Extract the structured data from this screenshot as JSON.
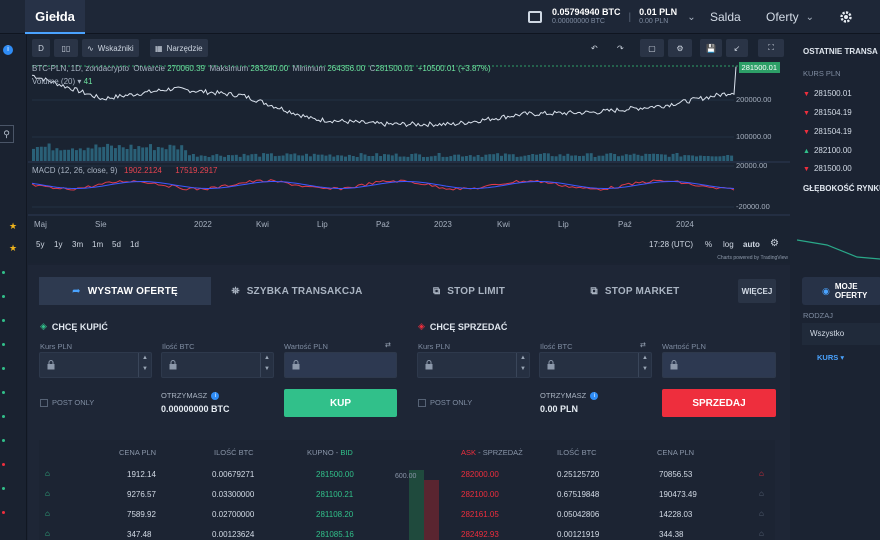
{
  "header": {
    "tab": "Giełda",
    "balance_btc": "0.05794940 BTC",
    "balance_btc_sub": "0.00000000 BTC",
    "balance_pln": "0.01 PLN",
    "balance_pln_sub": "0.00 PLN",
    "nav_salda": "Salda",
    "nav_oferty": "Oferty"
  },
  "chart_toolbar": {
    "d_label": "D",
    "indicators_label": "Wskaźniki",
    "tools_label": "Narzędzie"
  },
  "chart": {
    "symbol": "BTC-PLN, 1D, zondacrypto",
    "open_label": "Otwarcie",
    "open": "270060.39",
    "max_label": "Maksimum",
    "max": "283240.00",
    "min_label": "Minimum",
    "min": "264356.00",
    "close_label": "C",
    "close": "281500.01",
    "change": "+10500.01 (+3.87%)",
    "volume_label": "Volume (20)",
    "volume_value": "41",
    "macd_label": "MACD (12, 26, close, 9)",
    "macd_v1": "1902.2124",
    "macd_v2": "",
    "macd_v3": "17519.2917",
    "price_tag": "281500.01",
    "y_ticks": [
      "200000.00",
      "100000.00",
      "20000.00",
      "-20000.00"
    ],
    "x_ticks": [
      "Maj",
      "Sie",
      "2022",
      "Kwi",
      "Lip",
      "Paź",
      "2023",
      "Kwi",
      "Lip",
      "Paź",
      "2024"
    ],
    "timeframes": [
      "5y",
      "1y",
      "3m",
      "1m",
      "5d",
      "1d"
    ],
    "time": "17:28 (UTC)",
    "pct": "%",
    "log": "log",
    "auto": "auto",
    "powered": "Charts powered by TradingView"
  },
  "chart_data": {
    "type": "line",
    "title": "BTC-PLN, 1D, zondacrypto",
    "x": [
      "Maj",
      "Sie",
      "2022",
      "Kwi",
      "Lip",
      "Paź",
      "2023",
      "Kwi",
      "Lip",
      "Paź",
      "2024"
    ],
    "series": [
      {
        "name": "BTC-PLN",
        "values": [
          230000,
          160000,
          190000,
          170000,
          100000,
          85000,
          85000,
          115000,
          120000,
          140000,
          180000
        ]
      }
    ],
    "ylim": [
      0,
      260000
    ],
    "ylabel": "",
    "xlabel": ""
  },
  "right": {
    "title": "OSTATNIE TRANSA",
    "kurs": "KURS PLN",
    "trades": [
      {
        "dir": "down",
        "price": "281500.01"
      },
      {
        "dir": "down",
        "price": "281504.19"
      },
      {
        "dir": "down",
        "price": "281504.19"
      },
      {
        "dir": "up",
        "price": "282100.00"
      },
      {
        "dir": "down",
        "price": "281500.00"
      }
    ],
    "depth": "GŁĘBOKOŚĆ RYNKU",
    "moje": "MOJE OFERTY",
    "rodzaj": "RODZAJ",
    "wszystko": "Wszystko",
    "kurs_sort": "KURS"
  },
  "tabs": {
    "t1": "WYSTAW OFERTĘ",
    "t2": "SZYBKA TRANSAKCJA",
    "t3": "STOP LIMIT",
    "t4": "STOP MARKET",
    "more": "WIĘCEJ"
  },
  "buy": {
    "head": "CHCĘ KUPIĆ",
    "kurs": "Kurs PLN",
    "ilosc": "Ilość BTC",
    "wartosc": "Wartość PLN",
    "post": "POST ONLY",
    "recv_label": "OTRZYMASZ",
    "recv": "0.00000000 BTC",
    "button": "KUP"
  },
  "sell": {
    "head": "CHCĘ SPRZEDAĆ",
    "kurs": "Kurs PLN",
    "ilosc": "Ilość BTC",
    "wartosc": "Wartość PLN",
    "post": "POST ONLY",
    "recv_label": "OTRZYMASZ",
    "recv": "0.00 PLN",
    "button": "SPRZEDAJ"
  },
  "orderbook": {
    "h_cena": "CENA PLN",
    "h_ilosc": "ILOŚĆ BTC",
    "h_kupno": "KUPNO",
    "h_bid": "BID",
    "h_ask": "ASK",
    "h_sprzedaz": "SPRZEDAŻ",
    "h_ilosc2": "ILOŚĆ BTC",
    "h_cena2": "CENA PLN",
    "spread": "600.00",
    "rows": [
      {
        "bid_pln": "1912.14",
        "bid_btc": "0.00679271",
        "bid": "281500.00",
        "ask": "282000.00",
        "ask_btc": "0.25125720",
        "ask_pln": "70856.53"
      },
      {
        "bid_pln": "9276.57",
        "bid_btc": "0.03300000",
        "bid": "281100.21",
        "ask": "282100.00",
        "ask_btc": "0.67519848",
        "ask_pln": "190473.49"
      },
      {
        "bid_pln": "7589.92",
        "bid_btc": "0.02700000",
        "bid": "281108.20",
        "ask": "282161.05",
        "ask_btc": "0.05042806",
        "ask_pln": "14228.03"
      },
      {
        "bid_pln": "347.48",
        "bid_btc": "0.00123624",
        "bid": "281085.16",
        "ask": "282492.93",
        "ask_btc": "0.00121919",
        "ask_pln": "344.38"
      }
    ]
  }
}
